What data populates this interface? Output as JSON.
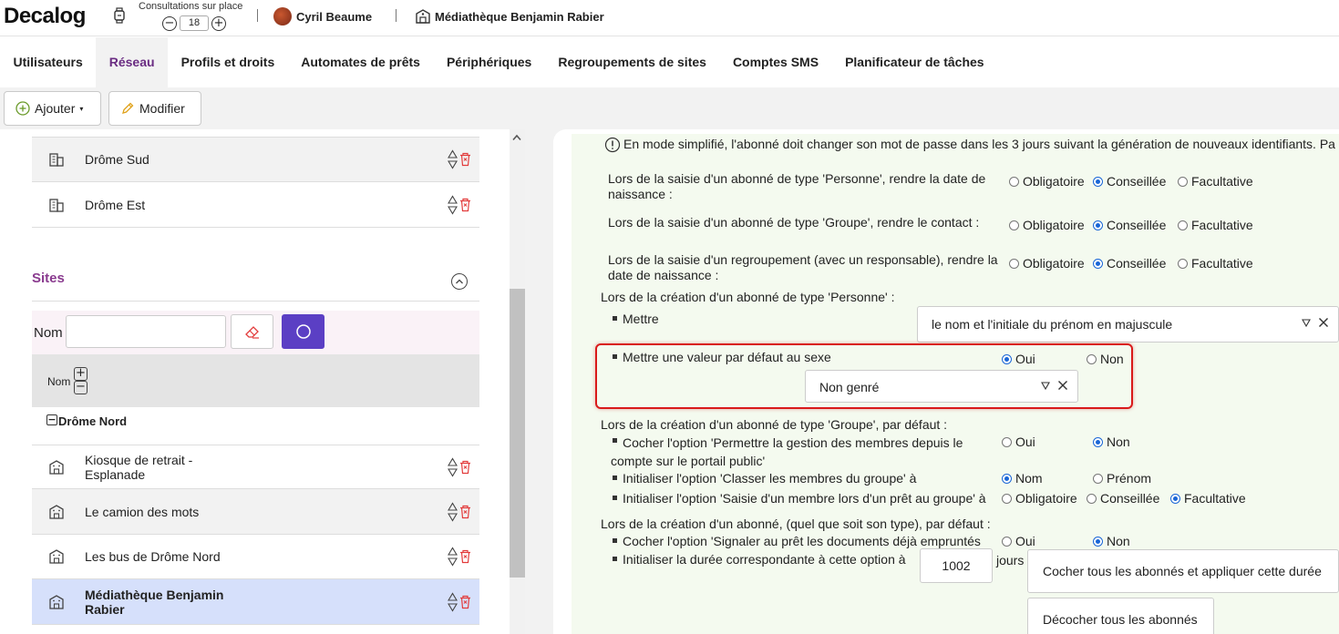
{
  "header": {
    "logo": "Decalog",
    "consultations_label": "Consultations sur place",
    "consultations_minus": "−",
    "consultations_value": "18",
    "consultations_plus": "+",
    "user_name": "Cyril Beaume",
    "library_name": "Médiathèque Benjamin Rabier"
  },
  "nav": {
    "tabs": [
      {
        "label": "Utilisateurs"
      },
      {
        "label": "Réseau"
      },
      {
        "label": "Profils et droits"
      },
      {
        "label": "Automates de prêts"
      },
      {
        "label": "Périphériques"
      },
      {
        "label": "Regroupements de sites"
      },
      {
        "label": "Comptes SMS"
      },
      {
        "label": "Planificateur de tâches"
      }
    ],
    "active_tab": "Réseau"
  },
  "toolbar": {
    "add_label": "Ajouter",
    "modify_label": "Modifier"
  },
  "left": {
    "networks": [
      {
        "name": "Drôme Sud"
      },
      {
        "name": "Drôme Est"
      }
    ],
    "sites_title": "Sites",
    "filter_label": "Nom",
    "filter_value": "",
    "column_name": "Nom",
    "sort_plus": "+",
    "sort_minus": "−",
    "group_toggle": "−",
    "group_name": "Drôme Nord",
    "sites": [
      {
        "name": "Kiosque de retrait - Esplanade",
        "selected": false
      },
      {
        "name": "Le camion des mots",
        "selected": false
      },
      {
        "name": "Les bus de Drôme Nord",
        "selected": false
      },
      {
        "name": "Médiathèque Benjamin Rabier",
        "selected": true
      }
    ]
  },
  "right": {
    "info": "En mode simplifié, l'abonné doit changer son mot de passe dans les 3 jours suivant la génération de nouveaux identifiants. Pa",
    "birthdate_person": "Lors de la saisie d'un abonné de type 'Personne', rendre la date de naissance :",
    "contact_group": "Lors de la saisie d'un abonné de type 'Groupe', rendre le contact :",
    "birthdate_group": "Lors de la saisie d'un regroupement (avec un responsable), rendre la date de naissance :",
    "opt_obligatoire": "Obligatoire",
    "opt_conseillee": "Conseillée",
    "opt_facultative": "Facultative",
    "person_creation": "Lors de la création d'un abonné de type 'Personne' :",
    "mettre": "Mettre",
    "name_format": "le nom et l'initiale du prénom en majuscule",
    "sex_default": "Mettre une valeur par défaut au sexe",
    "oui": "Oui",
    "non": "Non",
    "sex_value": "Non genré",
    "group_creation": "Lors de la création d'un abonné de type 'Groupe', par défaut :",
    "manage_members": "Cocher l'option 'Permettre la gestion des membres depuis le compte sur le portail public'",
    "sort_members": "Initialiser l'option 'Classer les membres du groupe' à",
    "opt_nom": "Nom",
    "opt_prenom": "Prénom",
    "member_loan": "Initialiser l'option 'Saisie d'un membre lors d'un prêt au groupe' à",
    "any_creation": "Lors de la création d'un abonné, (quel que soit son type), par défaut :",
    "signal_loan": "Cocher l'option 'Signaler au prêt les documents déjà empruntés",
    "duration": "Initialiser la durée correspondante à cette option à",
    "duration_value": "1002",
    "days": "jours",
    "apply_all": "Cocher tous les abonnés et appliquer cette durée",
    "uncheck_all": "Décocher tous les abonnés"
  }
}
